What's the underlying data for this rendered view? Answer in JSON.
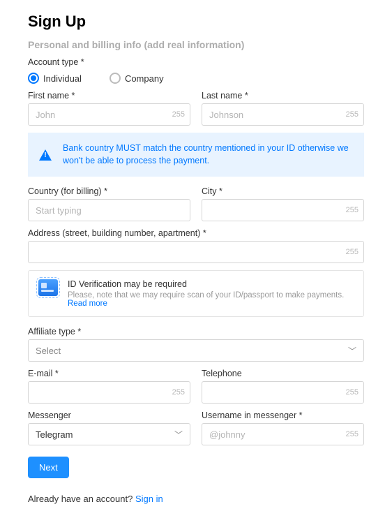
{
  "heading": "Sign Up",
  "section_subtitle": "Personal and billing info (add real information)",
  "account_type": {
    "label": "Account type *",
    "options": {
      "individual": "Individual",
      "company": "Company"
    },
    "selected": "individual"
  },
  "first_name": {
    "label": "First name *",
    "placeholder": "John",
    "counter": "255"
  },
  "last_name": {
    "label": "Last name *",
    "placeholder": "Johnson",
    "counter": "255"
  },
  "bank_alert": "Bank country MUST match the country mentioned in your ID otherwise we won't be able to process the payment.",
  "country": {
    "label": "Country (for billing) *",
    "placeholder": "Start typing"
  },
  "city": {
    "label": "City *",
    "counter": "255"
  },
  "address": {
    "label": "Address (street, building number, apartment) *",
    "counter": "255"
  },
  "id_verif": {
    "title": "ID Verification may be required",
    "subtitle": "Please, note that we may require scan of your ID/passport to make payments. ",
    "link": "Read more"
  },
  "affiliate": {
    "label": "Affiliate type *",
    "selected": "Select"
  },
  "email": {
    "label": "E-mail *",
    "counter": "255"
  },
  "telephone": {
    "label": "Telephone",
    "counter": "255"
  },
  "messenger": {
    "label": "Messenger",
    "selected": "Telegram"
  },
  "username": {
    "label": "Username in messenger *",
    "placeholder": "@johnny",
    "counter": "255"
  },
  "next_button": "Next",
  "signin": {
    "prefix": "Already have an account? ",
    "link": "Sign in"
  }
}
